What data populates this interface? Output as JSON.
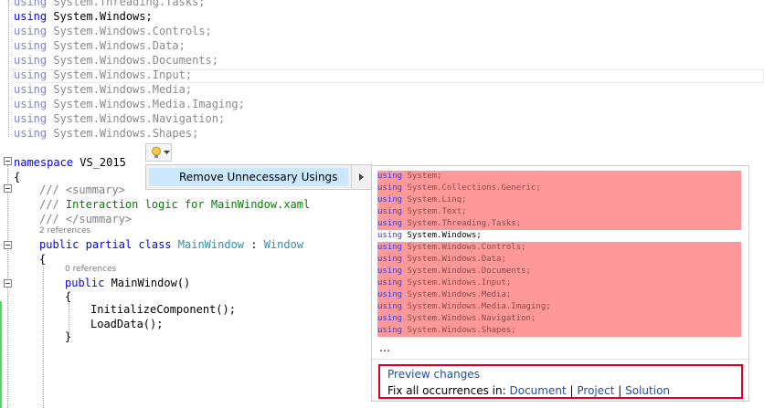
{
  "using_lines": [
    {
      "kw": "using",
      "ns": "System.Threading.Tasks;",
      "active": false
    },
    {
      "kw": "using",
      "ns": "System.Windows;",
      "active": true
    },
    {
      "kw": "using",
      "ns": "System.Windows.Controls;",
      "active": false
    },
    {
      "kw": "using",
      "ns": "System.Windows.Data;",
      "active": false
    },
    {
      "kw": "using",
      "ns": "System.Windows.Documents;",
      "active": false
    },
    {
      "kw": "using",
      "ns": "System.Windows.Input;",
      "active": false
    },
    {
      "kw": "using",
      "ns": "System.Windows.Media;",
      "active": false
    },
    {
      "kw": "using",
      "ns": "System.Windows.Media.Imaging;",
      "active": false
    },
    {
      "kw": "using",
      "ns": "System.Windows.Navigation;",
      "active": false
    },
    {
      "kw": "using",
      "ns": "System.Windows.Shapes;",
      "active": false
    }
  ],
  "code": {
    "namespace_kw": "namespace",
    "namespace_name": " VS_2015",
    "open_brace": "{",
    "summary_open_prefix": "/// ",
    "summary_open_tag": "<summary>",
    "summary_text_prefix": "/// ",
    "summary_text": "Interaction logic for MainWindow.xaml",
    "summary_close_prefix": "/// ",
    "summary_close_tag": "</summary>",
    "class_refs": "2 references",
    "class_public": "public",
    "class_partial": "partial",
    "class_kw": "class",
    "class_name": "MainWindow",
    "class_colon": " : ",
    "class_base": "Window",
    "class_brace": "{",
    "ctor_refs": "0 references",
    "ctor_public": "public",
    "ctor_sig": " MainWindow()",
    "ctor_brace": "{",
    "stmt1": "InitializeComponent();",
    "stmt2": "LoadData();",
    "ctor_close": "}"
  },
  "lightbulb": {
    "icon": "lightbulb-icon",
    "dropdown": "chevron-down-icon"
  },
  "quick_actions_menu": {
    "item": "Remove Unnecessary Usings",
    "submenu_arrow": "chevron-right-icon"
  },
  "preview": {
    "lines": [
      {
        "kw": "using",
        "ns": "System;",
        "removed": true
      },
      {
        "kw": "using",
        "ns": "System.Collections.Generic;",
        "removed": true
      },
      {
        "kw": "using",
        "ns": "System.Linq;",
        "removed": true
      },
      {
        "kw": "using",
        "ns": "System.Text;",
        "removed": true
      },
      {
        "kw": "using",
        "ns": "System.Threading.Tasks;",
        "removed": true
      },
      {
        "kw": "using",
        "ns": "System.Windows;",
        "removed": false
      },
      {
        "kw": "using",
        "ns": "System.Windows.Controls;",
        "removed": true
      },
      {
        "kw": "using",
        "ns": "System.Windows.Data;",
        "removed": true
      },
      {
        "kw": "using",
        "ns": "System.Windows.Documents;",
        "removed": true
      },
      {
        "kw": "using",
        "ns": "System.Windows.Input;",
        "removed": true
      },
      {
        "kw": "using",
        "ns": "System.Windows.Media;",
        "removed": true
      },
      {
        "kw": "using",
        "ns": "System.Windows.Media.Imaging;",
        "removed": true
      },
      {
        "kw": "using",
        "ns": "System.Windows.Navigation;",
        "removed": true
      },
      {
        "kw": "using",
        "ns": "System.Windows.Shapes;",
        "removed": true
      }
    ],
    "ellipsis": "…",
    "preview_changes": "Preview changes",
    "fix_all_label": "Fix all occurrences in:",
    "scope_document": "Document",
    "scope_project": "Project",
    "scope_solution": "Solution",
    "separator": "|"
  },
  "colors": {
    "removed_bg": "#ff9999",
    "keyword": "#0000ff",
    "comment": "#008000",
    "type": "#2b91af",
    "link": "#1e50a2",
    "highlight_border": "#e0001b",
    "menu_selected": "#cce8ff"
  }
}
